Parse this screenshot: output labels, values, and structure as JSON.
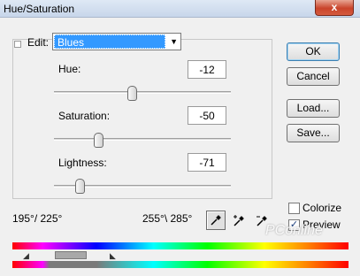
{
  "window": {
    "title": "Hue/Saturation",
    "close_glyph": "x"
  },
  "edit": {
    "label": "Edit:",
    "value": "Blues"
  },
  "params": {
    "hue": {
      "label": "Hue:",
      "value": "-12",
      "slider_fraction": 0.44
    },
    "saturation": {
      "label": "Saturation:",
      "value": "-50",
      "slider_fraction": 0.25
    },
    "lightness": {
      "label": "Lightness:",
      "value": "-71",
      "slider_fraction": 0.145
    }
  },
  "buttons": {
    "ok": "OK",
    "cancel": "Cancel",
    "load": "Load...",
    "save": "Save..."
  },
  "ranges": {
    "left": "195°/ 225°",
    "right": "255°\\ 285°"
  },
  "eyedroppers": [
    {
      "icon": "eyedropper-icon",
      "selected": true
    },
    {
      "icon": "eyedropper-plus-icon",
      "selected": false
    },
    {
      "icon": "eyedropper-minus-icon",
      "selected": false
    }
  ],
  "options": {
    "colorize": {
      "label": "Colorize",
      "checked": false
    },
    "preview": {
      "label": "Preview",
      "checked": true,
      "check_glyph": "✓"
    }
  },
  "watermark": "PConline"
}
